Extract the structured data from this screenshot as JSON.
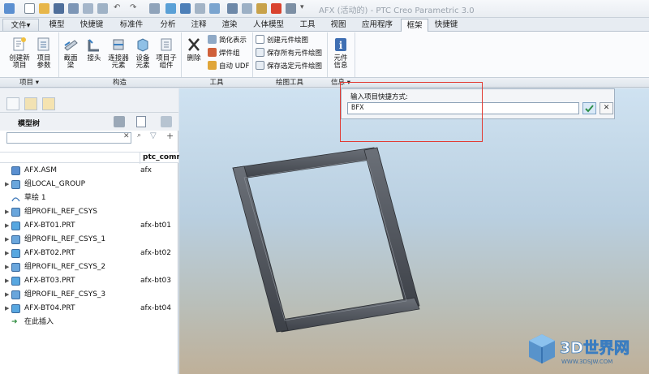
{
  "window": {
    "title": "AFX (活动的) - PTC Creo Parametric 3.0"
  },
  "tabs": [
    "文件▾",
    "模型",
    "快捷键",
    "标准件",
    "分析",
    "注释",
    "渲染",
    "人体模型",
    "工具",
    "视图",
    "应用程序",
    "框架",
    "快捷键"
  ],
  "active_tab_index": 11,
  "ribbon": {
    "buttons": [
      {
        "label1": "创建新",
        "label2": "项目"
      },
      {
        "label1": "项目",
        "label2": "参数"
      },
      {
        "label1": "截面",
        "label2": "梁"
      },
      {
        "label1": "接头",
        "label2": ""
      },
      {
        "label1": "连接器",
        "label2": "元素"
      },
      {
        "label1": "设备",
        "label2": "元素"
      },
      {
        "label1": "项目子",
        "label2": "组件"
      },
      {
        "label1": "删除",
        "label2": ""
      },
      {
        "label1": "元件",
        "label2": "信息"
      }
    ],
    "tools_small": [
      "简化表示",
      "焊件组",
      "自动 UDF"
    ],
    "drawing_small": [
      "创建元件绘图",
      "保存所有元件绘图",
      "保存选定元件绘图"
    ],
    "groups": [
      "项目 ▾",
      "构造",
      "工具",
      "绘图工具",
      "信息 ▾"
    ]
  },
  "model_tree": {
    "title": "模型树",
    "column_header": "ptc_comn",
    "rows": [
      {
        "name": "AFX.ASM",
        "value": "afx",
        "expand": "",
        "icon": "assembly-icon"
      },
      {
        "name": "组LOCAL_GROUP",
        "value": "",
        "expand": "▶",
        "icon": "group-icon"
      },
      {
        "name": "草绘 1",
        "value": "",
        "expand": "",
        "icon": "sketch-icon"
      },
      {
        "name": "组PROFIL_REF_CSYS",
        "value": "",
        "expand": "▶",
        "icon": "group-icon"
      },
      {
        "name": "AFX-BT01.PRT",
        "value": "afx-bt01",
        "expand": "▶",
        "icon": "part-icon"
      },
      {
        "name": "组PROFIL_REF_CSYS_1",
        "value": "",
        "expand": "▶",
        "icon": "group-icon"
      },
      {
        "name": "AFX-BT02.PRT",
        "value": "afx-bt02",
        "expand": "▶",
        "icon": "part-icon"
      },
      {
        "name": "组PROFIL_REF_CSYS_2",
        "value": "",
        "expand": "▶",
        "icon": "group-icon"
      },
      {
        "name": "AFX-BT03.PRT",
        "value": "afx-bt03",
        "expand": "▶",
        "icon": "part-icon"
      },
      {
        "name": "组PROFIL_REF_CSYS_3",
        "value": "",
        "expand": "▶",
        "icon": "group-icon"
      },
      {
        "name": "AFX-BT04.PRT",
        "value": "afx-bt04",
        "expand": "▶",
        "icon": "part-icon"
      },
      {
        "name": "在此插入",
        "value": "",
        "expand": "",
        "icon": "insert-here-icon"
      }
    ]
  },
  "dialog": {
    "label": "输入项目快捷方式:",
    "value": "BFX"
  },
  "watermark": {
    "brand": "3D世界网",
    "url": "WWW.3DSJW.COM"
  },
  "colors": {
    "highlight": "#e23a32",
    "frame": "#4b4f56",
    "accent": "#3a7fc1"
  }
}
